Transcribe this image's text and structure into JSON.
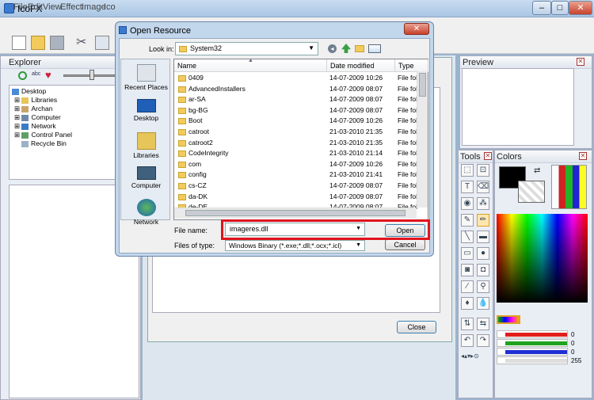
{
  "app": {
    "title": "IcoFX"
  },
  "menu": [
    "File",
    "Edit",
    "View",
    "Effect",
    "Image",
    "Ico"
  ],
  "explorer": {
    "title": "Explorer",
    "tree": [
      "Desktop",
      "Libraries",
      "Archan",
      "Computer",
      "Network",
      "Control Panel",
      "Recycle Bin"
    ]
  },
  "preview": {
    "title": "Preview"
  },
  "tools": {
    "title": "Tools"
  },
  "colors": {
    "title": "Colors",
    "values": [
      "0",
      "0",
      "0",
      "255"
    ],
    "bar_colors": [
      "#e11d1d",
      "#1fa31f",
      "#1f2fd3",
      "#dddddd"
    ]
  },
  "inner_dialog": {
    "close_label": "Close"
  },
  "dialog": {
    "title": "Open Resource",
    "look_in_label": "Look in:",
    "look_in_value": "System32",
    "places": [
      "Recent Places",
      "Desktop",
      "Libraries",
      "Computer",
      "Network"
    ],
    "columns": {
      "name": "Name",
      "date": "Date modified",
      "type": "Type"
    },
    "files": [
      {
        "name": "0409",
        "date": "14-07-2009 10:26",
        "type": "File fol"
      },
      {
        "name": "AdvancedInstallers",
        "date": "14-07-2009 08:07",
        "type": "File fol"
      },
      {
        "name": "ar-SA",
        "date": "14-07-2009 08:07",
        "type": "File fol"
      },
      {
        "name": "bg-BG",
        "date": "14-07-2009 08:07",
        "type": "File fol"
      },
      {
        "name": "Boot",
        "date": "14-07-2009 10:26",
        "type": "File fol"
      },
      {
        "name": "catroot",
        "date": "21-03-2010 21:35",
        "type": "File fol"
      },
      {
        "name": "catroot2",
        "date": "21-03-2010 21:35",
        "type": "File fol"
      },
      {
        "name": "CodeIntegrity",
        "date": "21-03-2010 21:14",
        "type": "File fol"
      },
      {
        "name": "com",
        "date": "14-07-2009 10:26",
        "type": "File fol"
      },
      {
        "name": "config",
        "date": "21-03-2010 21:41",
        "type": "File fol"
      },
      {
        "name": "cs-CZ",
        "date": "14-07-2009 08:07",
        "type": "File fol"
      },
      {
        "name": "da-DK",
        "date": "14-07-2009 08:07",
        "type": "File fol"
      },
      {
        "name": "de-DE",
        "date": "14-07-2009 08:07",
        "type": "File fol"
      }
    ],
    "file_name_label": "File name:",
    "file_name_value": "imageres.dll",
    "files_of_type_label": "Files of type:",
    "files_of_type_value": "Windows Binary (*.exe;*.dll;*.ocx;*.icl)",
    "open_label": "Open",
    "cancel_label": "Cancel"
  }
}
